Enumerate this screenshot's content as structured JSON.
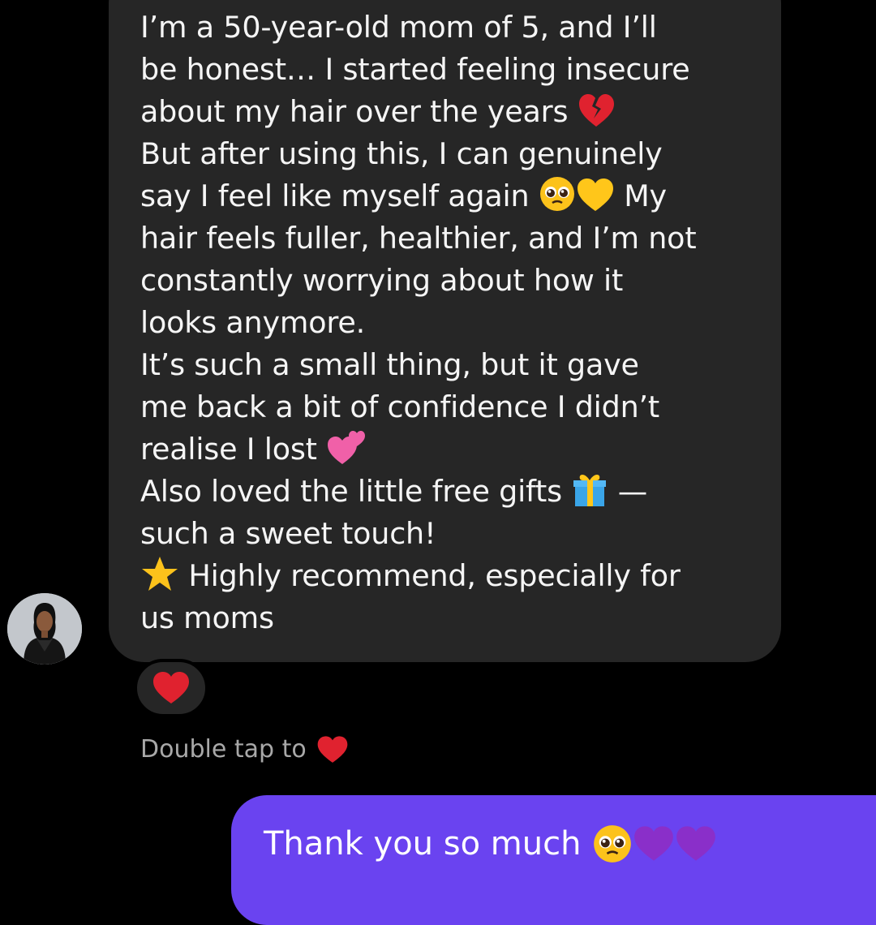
{
  "thread": {
    "incoming_message": {
      "line1": "I’m a 50-year-old mom of 5, and I’ll",
      "line2": "be honest… I started feeling insecure",
      "line3": "about my hair over the years",
      "line4": "But after using this, I can genuinely",
      "line5a": "say I feel like myself again",
      "line5b": "My",
      "line6": "hair feels fuller, healthier, and I’m not",
      "line7": "constantly worrying about how it",
      "line8": "looks anymore.",
      "line9": "It’s such a small thing, but it gave",
      "line10": "me back a bit of confidence I didn’t",
      "line11": "realise I lost",
      "line12a": "Also loved the little free gifts",
      "line12b": "—",
      "line13": "such a sweet touch!",
      "line14": "Highly recommend, especially for",
      "line15": "us moms"
    },
    "emojis": {
      "broken_heart": "broken-heart-icon",
      "pleading_face": "pleading-face-icon",
      "yellow_heart": "yellow-heart-icon",
      "two_hearts": "two-hearts-icon",
      "gift": "gift-icon",
      "star": "star-icon",
      "red_heart": "red-heart-icon",
      "purple_heart": "purple-heart-icon"
    },
    "reaction": "red-heart-icon",
    "hint_text": "Double tap to",
    "outgoing_message": "Thank you so much"
  },
  "colors": {
    "background": "#000000",
    "incoming_bubble": "#262626",
    "outgoing_bubble": "#6a43f0",
    "hint_text": "#a8a8a8",
    "heart_red": "#e0222f"
  }
}
